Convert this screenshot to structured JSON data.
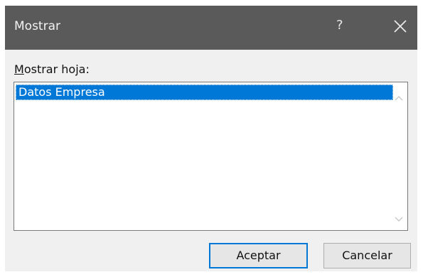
{
  "dialog": {
    "title": "Mostrar",
    "help_glyph": "?",
    "close_icon": "close-icon"
  },
  "form": {
    "label": "Mostrar hoja:",
    "label_mnemonic": "M",
    "label_rest": "ostrar hoja:",
    "items": [
      {
        "label": "Datos Empresa",
        "selected": true
      }
    ],
    "scroll_up_icon": "chevron-up-icon",
    "scroll_down_icon": "chevron-down-icon"
  },
  "buttons": {
    "ok_label": "Aceptar",
    "cancel_label": "Cancelar"
  },
  "colors": {
    "titlebar": "#5a5a5a",
    "selection": "#0078d7",
    "dialog_bg": "#f0f0f0"
  }
}
